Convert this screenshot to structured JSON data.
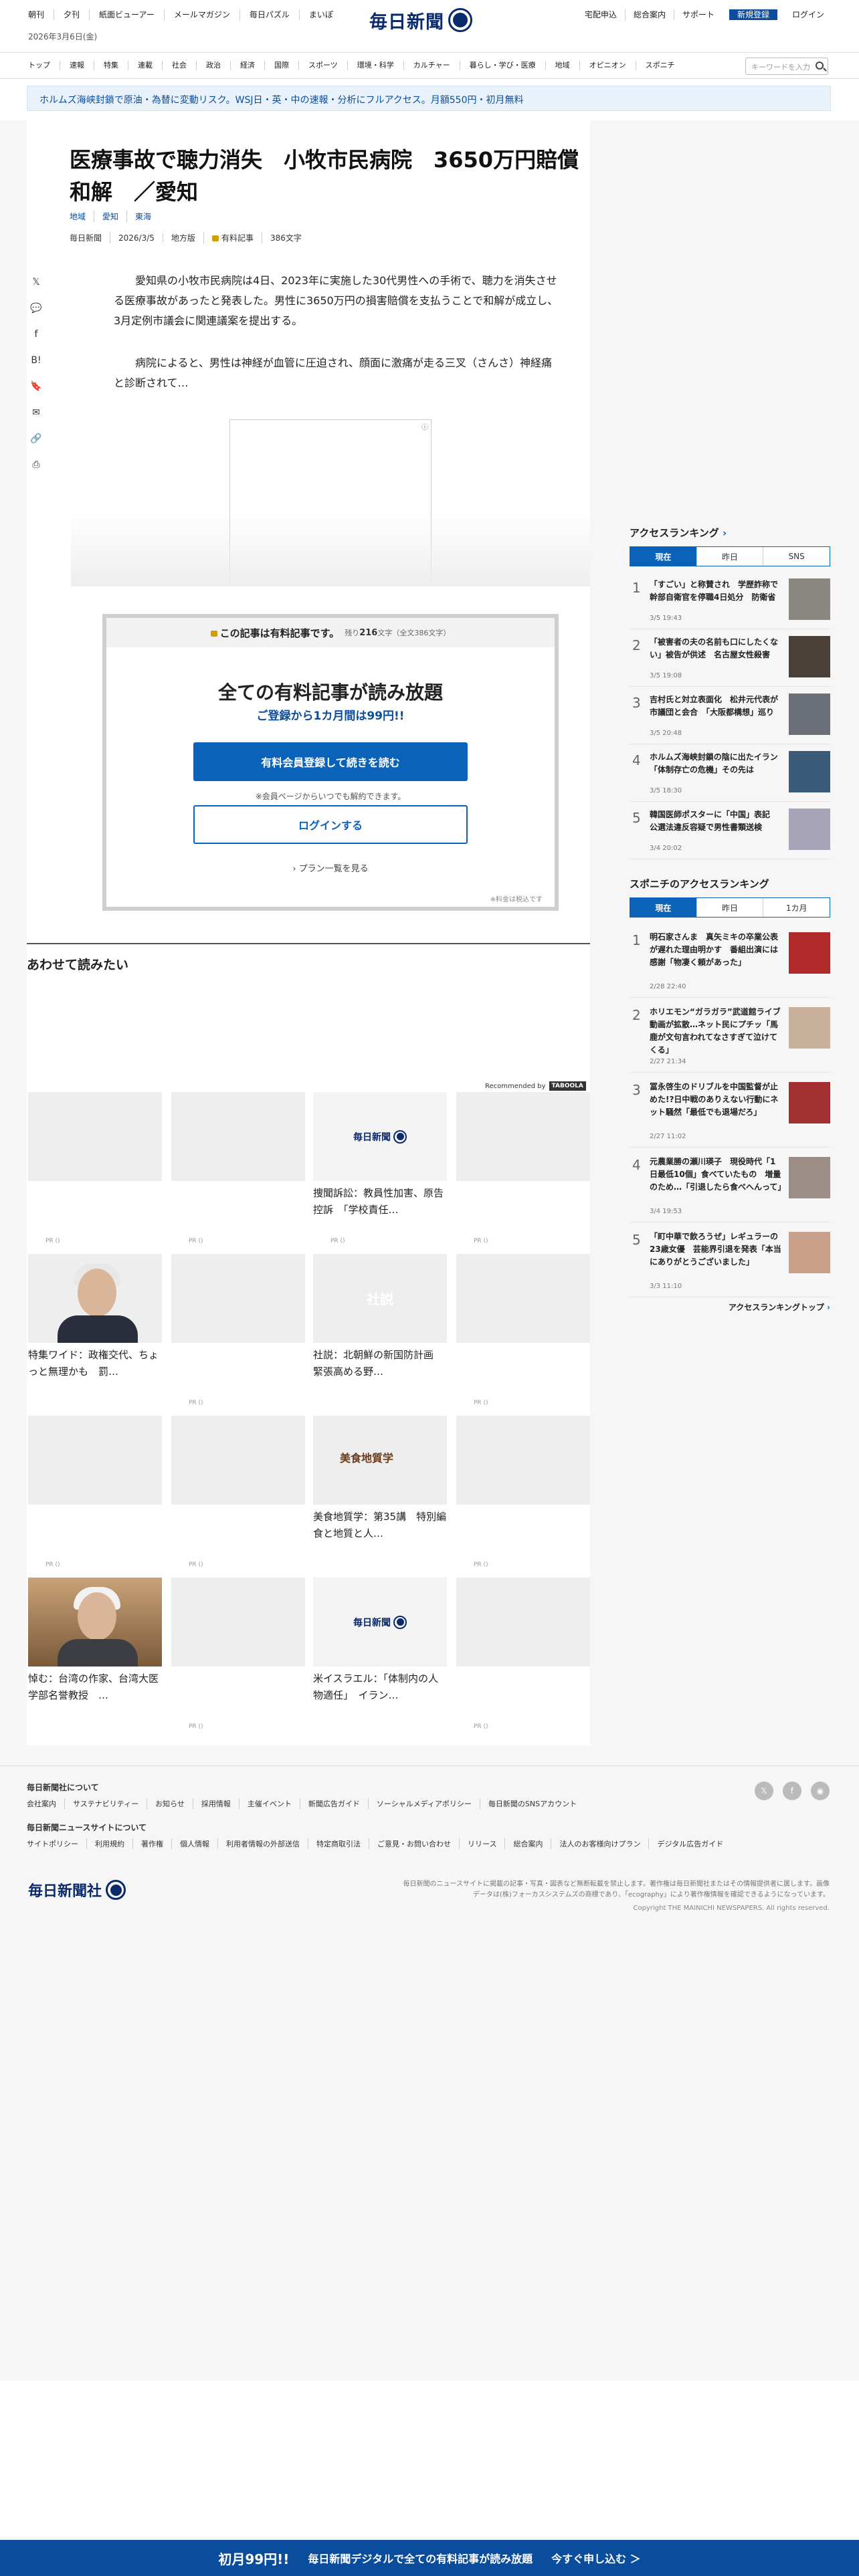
{
  "header": {
    "nav": [
      "朝刊",
      "夕刊",
      "紙面ビューアー",
      "メールマガジン",
      "毎日パズル",
      "まいぽ"
    ],
    "date": "2026年3月6日(金)",
    "logo": "毎日新聞",
    "right_links": [
      "宅配申込",
      "総合案内",
      "サポート"
    ],
    "register": "新規登録",
    "login": "ログイン"
  },
  "categories": [
    "トップ",
    "速報",
    "特集",
    "連載",
    "社会",
    "政治",
    "経済",
    "国際",
    "スポーツ",
    "環境・科学",
    "カルチャー",
    "暮らし・学び・医療",
    "地域",
    "オピニオン",
    "スポニチ"
  ],
  "search": {
    "placeholder": "キーワードを入力"
  },
  "banner": "ホルムズ海峡封鎖で原油・為替に変動リスク。WSJ日・英・中の速報・分析にフルアクセス。月額550円・初月無料",
  "article": {
    "title": "医療事故で聴力消失　小牧市民病院　3650万円賠償和解　／愛知",
    "tags": [
      "地域",
      "愛知",
      "東海"
    ],
    "meta": {
      "source": "毎日新聞",
      "date": "2026/3/5",
      "edition": "地方版",
      "paid": "有料記事",
      "chars": "386文字"
    },
    "p1": "愛知県の小牧市民病院は4日、2023年に実施した30代男性への手術で、聴力を消失させる医療事故があったと発表した。男性に3650万円の損害賠償を支払うことで和解が成立し、3月定例市議会に関連議案を提出する。",
    "p2": "病院によると、男性は神経が血管に圧迫され、顔面に激痛が走る三叉（さんさ）神経痛と診断されて…"
  },
  "share_icons": [
    "x-icon",
    "comment-icon",
    "facebook-icon",
    "hatena-icon",
    "bookmark-icon",
    "mail-icon",
    "link-icon",
    "print-icon"
  ],
  "share_glyphs": [
    "𝕏",
    "💬",
    "f",
    "B!",
    "🔖",
    "✉",
    "🔗",
    "⎙"
  ],
  "paywall": {
    "head": "この記事は有料記事です。",
    "remain_pre": "残り",
    "remain": "216",
    "remain_post": "文字（全文386文字）",
    "title": "全ての有料記事が読み放題",
    "sub": "ご登録から1カ月間は99円!!",
    "primary": "有料会員登録して続きを読む",
    "note": "※会員ページからいつでも解約できます。",
    "login": "ログインする",
    "plans": "プラン一覧を見る",
    "tax": "※料金は税込です"
  },
  "also": {
    "title": "あわせて読みたい",
    "recommended": "Recommended by",
    "taboola": "TABOOLA",
    "pr": "PR ()"
  },
  "cards": [
    {
      "cap": ""
    },
    {
      "cap": ""
    },
    {
      "cap": "捜聞訴訟：教員性加害、原告控訴　「学校責任…"
    },
    {
      "cap": ""
    },
    {
      "cap": "特集ワイド：政権交代、ちょっと無理かも　罰…"
    },
    {
      "cap": ""
    },
    {
      "cap": "社説：北朝鮮の新国防計画　緊張高める野…"
    },
    {
      "cap": ""
    },
    {
      "cap": ""
    },
    {
      "cap": ""
    },
    {
      "cap": "美食地質学：第35講　特別編　食と地質と人…"
    },
    {
      "cap": ""
    },
    {
      "cap": "悼む：台湾の作家、台湾大医学部名誉教授　…"
    },
    {
      "cap": ""
    },
    {
      "cap": "米イスラエル：「体制内の人物適任」　イラン…"
    },
    {
      "cap": ""
    }
  ],
  "shasetsu_label": "社説",
  "food_label": "美食地質学",
  "ranking": {
    "title": "アクセスランキング",
    "tabs": [
      "現在",
      "昨日",
      "SNS"
    ],
    "items": [
      {
        "n": "1",
        "t": "「すごい」と称賛され　学歴詐称で幹部自衛官を停職4日処分　防衛省",
        "d": "3/5 19:43"
      },
      {
        "n": "2",
        "t": "「被害者の夫の名前も口にしたくない」被告が供述　名古屋女性殺害",
        "d": "3/5 19:08"
      },
      {
        "n": "3",
        "t": "吉村氏と対立表面化　松井元代表が市議団と会合　「大阪都構想」巡り",
        "d": "3/5 20:48"
      },
      {
        "n": "4",
        "t": "ホルムズ海峡封鎖の陰に出たイラン　「体制存亡の危機」その先は",
        "d": "3/5 18:30"
      },
      {
        "n": "5",
        "t": "韓国医師ポスターに「中国」表記　公選法違反容疑で男性書類送検",
        "d": "3/4 20:02"
      }
    ]
  },
  "sponichi": {
    "title": "スポニチのアクセスランキング",
    "tabs": [
      "現在",
      "昨日",
      "1カ月"
    ],
    "items": [
      {
        "n": "1",
        "t": "明石家さんま　真矢ミキの卒業公表が遅れた理由明かす　番組出演には感謝「物凄く頼があった」",
        "d": "2/28 22:40"
      },
      {
        "n": "2",
        "t": "ホリエモン“ガラガラ”武道館ライブ動画が拡散…ネット民にプチッ「馬鹿が文句言われてなさすぎて泣けてくる」",
        "d": "2/27 21:34"
      },
      {
        "n": "3",
        "t": "冨永啓生のドリブルを中国監督が止めた!?日中戦のありえない行動にネット騒然「最低でも退場だろ」",
        "d": "2/27 11:02"
      },
      {
        "n": "4",
        "t": "元農業勝の瀬川瑛子　現役時代「1日最低10個」食べていたもの　増量のため…「引退したら食べへんって」",
        "d": "3/4 19:53"
      },
      {
        "n": "5",
        "t": "「町中華で飲ろうぜ」レギュラーの23歳女優　芸能界引退を発表「本当にありがとうございました」",
        "d": "3/3 11:10"
      }
    ],
    "more": "アクセスランキングトップ"
  },
  "footer": {
    "about_title": "毎日新聞社について",
    "about_links": [
      "会社案内",
      "サステナビリティー",
      "お知らせ",
      "採用情報",
      "主催イベント",
      "新聞広告ガイド",
      "ソーシャルメディアポリシー",
      "毎日新聞のSNSアカウント"
    ],
    "site_title": "毎日新聞ニュースサイトについて",
    "site_links": [
      "サイトポリシー",
      "利用規約",
      "著作権",
      "個人情報",
      "利用者情報の外部送信",
      "特定商取引法",
      "ご意見・お問い合わせ",
      "リリース",
      "総合案内",
      "法人のお客様向けプラン",
      "デジタル広告ガイド"
    ],
    "social": [
      "𝕏",
      "f",
      "◉"
    ],
    "logo": "毎日新聞社",
    "note": "毎日新聞のニュースサイトに掲載の記事・写真・図表など無断転載を禁止します。著作権は毎日新聞社またはその情報提供者に属します。画像データは(株)フォーカスシステムズの商標であり、「ecography」により著作権情報を確認できるようになっています。",
    "copyright": "Copyright THE MAINICHI NEWSPAPERS. All rights reserved."
  },
  "bottom_bar": {
    "big": "初月99円!!",
    "text": "毎日新聞デジタルで全ての有料記事が読み放題",
    "cta": "今すぐ申し込む ＞"
  }
}
